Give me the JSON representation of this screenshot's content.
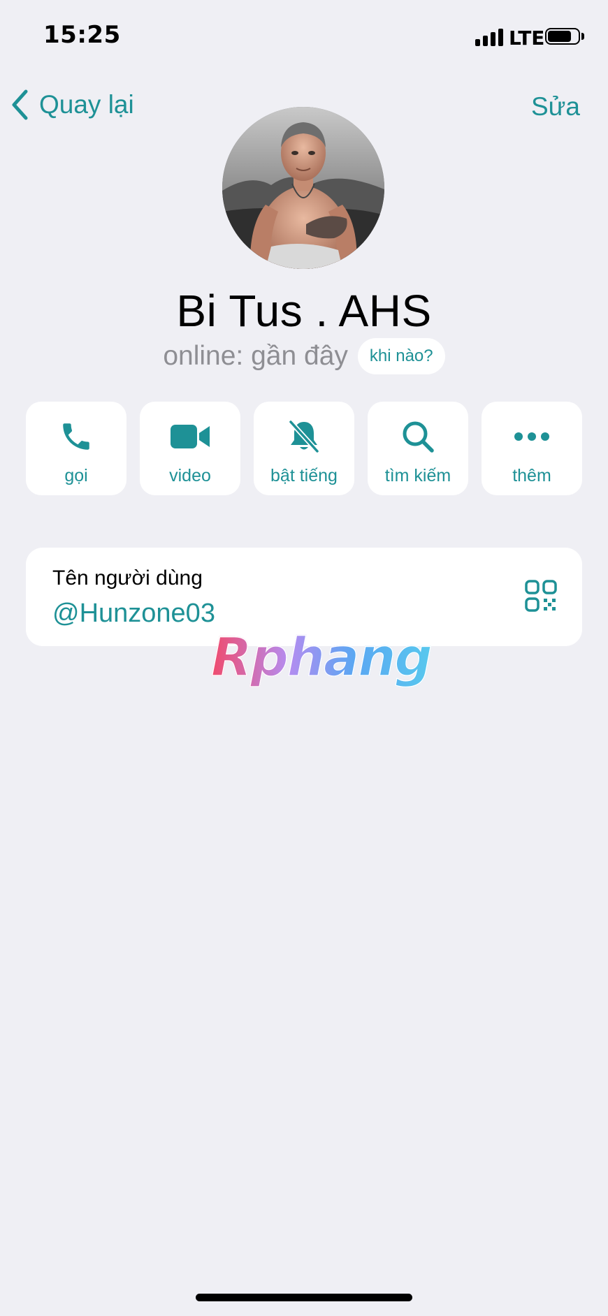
{
  "status_bar": {
    "time": "15:25",
    "network": "LTE",
    "signal_bars": 4,
    "battery_level": 0.8
  },
  "nav": {
    "back_label": "Quay lại",
    "edit_label": "Sửa"
  },
  "profile": {
    "name": "Bi Tus . AHS",
    "status": "online: gần đây",
    "when_badge": "khi nào?"
  },
  "actions": [
    {
      "label": "gọi",
      "icon": "phone-icon"
    },
    {
      "label": "video",
      "icon": "video-camera-icon"
    },
    {
      "label": "bật tiếng",
      "icon": "bell-slash-icon"
    },
    {
      "label": "tìm kiếm",
      "icon": "search-icon"
    },
    {
      "label": "thêm",
      "icon": "more-dots-icon"
    }
  ],
  "username_card": {
    "label": "Tên người dùng",
    "value": "@Hunzone03"
  },
  "watermark": "Rphang",
  "colors": {
    "accent": "#1e9196",
    "background": "#efeff4",
    "card": "#ffffff",
    "secondary_text": "#8e8e93"
  }
}
